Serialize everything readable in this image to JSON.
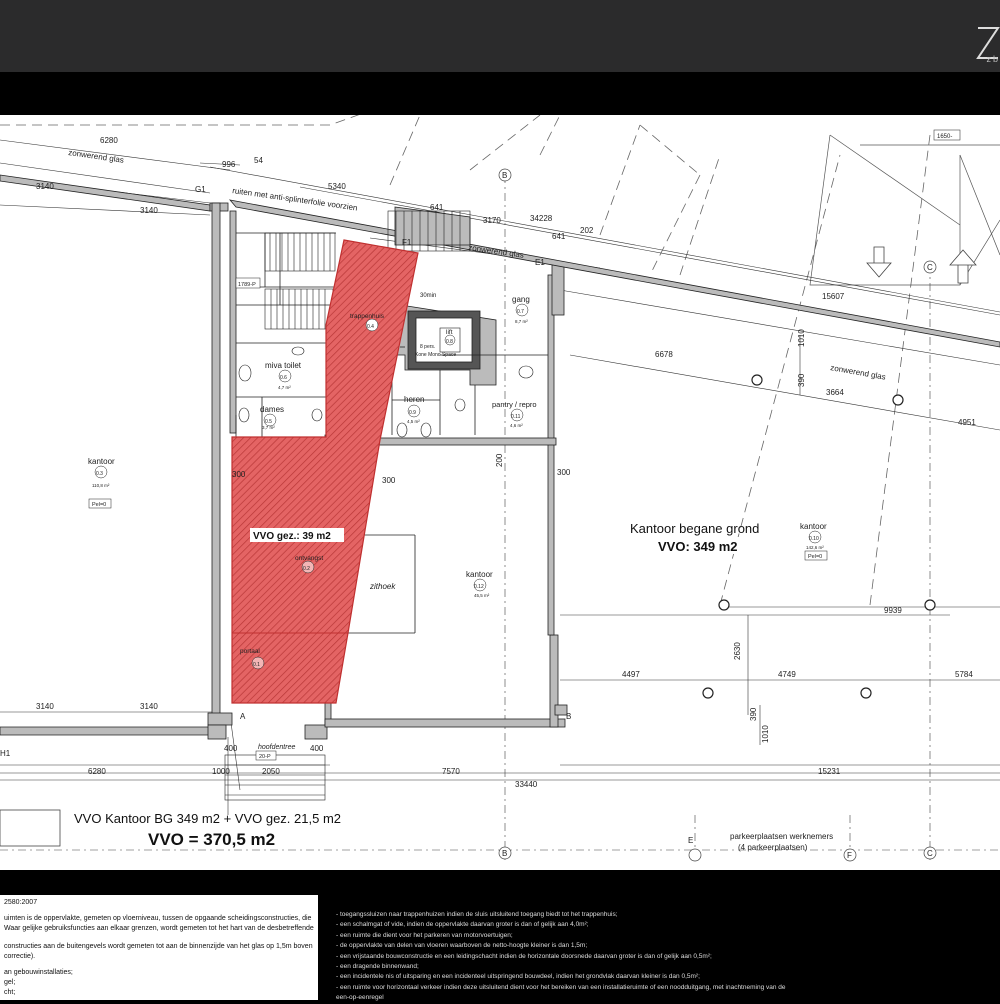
{
  "header": {
    "logo_text": "zb"
  },
  "plan": {
    "dims": {
      "top_6280": "6280",
      "top_3140a": "3140",
      "top_3140b": "3140",
      "top_996": "996",
      "top_54": "54",
      "top_5340": "5340",
      "top_641a": "641",
      "top_3170": "3170",
      "top_34228": "34228",
      "top_202": "202",
      "top_641b": "641",
      "top_15607": "15607",
      "right_1010a": "1010",
      "right_390a": "390",
      "mid_6678": "6678",
      "mid_3664": "3664",
      "right_4951": "4951",
      "mid_200": "200",
      "mid_300a": "300",
      "mid_300b": "300",
      "mid_300c": "300",
      "mid_9939": "9939",
      "mid_2630": "2630",
      "bot_4497": "4497",
      "bot_4749": "4749",
      "bot_5784": "5784",
      "bot_3140a": "3140",
      "bot_3140b": "3140",
      "right_390b": "390",
      "right_1010b": "1010",
      "b_400a": "400",
      "b_400b": "400",
      "b_6280": "6280",
      "b_1000": "1000",
      "b_2050": "2050",
      "b_7570": "7570",
      "b_15231": "15231",
      "b_33440": "33440",
      "tr_1650": "1650-"
    },
    "grid": {
      "B_top": "B",
      "C_top": "C",
      "G1": "G1",
      "F1": "F1",
      "E1": "E1",
      "A_bot": "A",
      "B_bot": "B",
      "B_low": "B",
      "E_low": "E",
      "F_low": "F",
      "C_low": "C",
      "H1": "H1"
    },
    "notes": {
      "zonwerend1": "zonwerend glas",
      "ruiten": "ruiten met anti-splinterfolie voorzien",
      "zonwerend2": "zonwerend glas",
      "zonwerend3": "zonwerend glas",
      "hoofdentree": "hoofdentree",
      "parkeer1": "parkeerplaatsen werknemers",
      "parkeer2": "(4 parkeerplaatsen)",
      "lift_note1": "8 pers.",
      "lift_note2": "Kone Mono Space",
      "d30min": "30min",
      "tag_1789": "1789-P",
      "tag_20p": "20-P",
      "tag_pel0a": "Pel=0",
      "tag_pel0b": "Pel=0"
    },
    "rooms": {
      "kantoor_left": "kantoor",
      "kantoor_left_no": "0.3",
      "kantoor_left_area": "110,8 m²",
      "miva": "miva toilet",
      "miva_no": "0.6",
      "miva_area": "4,7 m²",
      "dames": "dames",
      "dames_no": "0.5",
      "dames_area": "3,7 m²",
      "trappenhuis": "trappenhuis",
      "trappenhuis_no": "0.4",
      "lift": "lift",
      "lift_no": "0.8",
      "gang": "gang",
      "gang_no": "0.7",
      "gang_area": "8,7 m²",
      "heren": "heren",
      "heren_no": "0.9",
      "heren_area": "4,5 m²",
      "pantry": "pantry / repro",
      "pantry_no": "0.11",
      "pantry_area": "4,6 m²",
      "kantoor_mid": "kantoor",
      "kantoor_mid_no": "0.12",
      "kantoor_mid_area": "45,5 m²",
      "zithoek": "zithoek",
      "ontvangst": "ontvangst",
      "ontvangst_no": "0.2",
      "portaal": "portaal",
      "portaal_no": "0.1",
      "kantoor_right": "kantoor",
      "kantoor_right_no": "0.10",
      "kantoor_right_area": "142,6 m²"
    },
    "vvo_gez": "VVO gez.: 39 m2",
    "kantoor_bg_title": "Kantoor begane grond",
    "kantoor_bg_vvo": "VVO: 349 m2",
    "summary_line1": "VVO Kantoor BG 349 m2 + VVO gez. 21,5 m2",
    "summary_line2": "VVO = 370,5 m2",
    "colors": {
      "hatch_red": "#e85a5a",
      "line": "#222222",
      "wall": "#b8b8b8",
      "dash": "#555555"
    }
  },
  "legend_left": {
    "title": "2580:2007",
    "lines": [
      "uimten is de oppervlakte, gemeten op vloerniveau, tussen de opgaande scheidingsconstructies, die",
      "Waar gelijke gebruiksfuncties aan elkaar grenzen, wordt gemeten tot het hart van de desbetreffende",
      "",
      "constructies aan de buitengevels wordt gemeten tot aan de binnenzijde van het glas op 1,5m boven",
      "correctie).",
      "",
      "an gebouwinstallaties;",
      "gel;",
      "cht;"
    ]
  },
  "legend_right": {
    "lines": [
      "- toegangssluizen naar trappenhuizen indien de sluis uitsluitend toegang biedt  tot het trappenhuis;",
      "- een schalmgat of vide, indien de oppervlakte daarvan groter is dan of gelijk aan 4,0m²;",
      "- een ruimte die dient voor het parkeren van motorvoertuigen;",
      "- de oppervlakte  van delen van vloeren waarboven de netto-hoogte kleiner is dan 1,5m;",
      "- een vrijstaande bouwconstructie en een leidingschacht indien de horizontale doorsnede daarvan groter is dan of gelijk aan 0,5m²;",
      "- een dragende binnenwand;",
      "- een incidentele nis of uitsparing en een incidenteel uitspringend bouwdeel, indien het grondvlak daarvan kleiner is dan 0,5m²;",
      "- een ruimte voor horizontaal verkeer indien deze uitsluitend dient voor het bereiken van een installatieruimte of een noodduitgang, met inachtneming van     de",
      "  een-op-eenregel"
    ]
  }
}
